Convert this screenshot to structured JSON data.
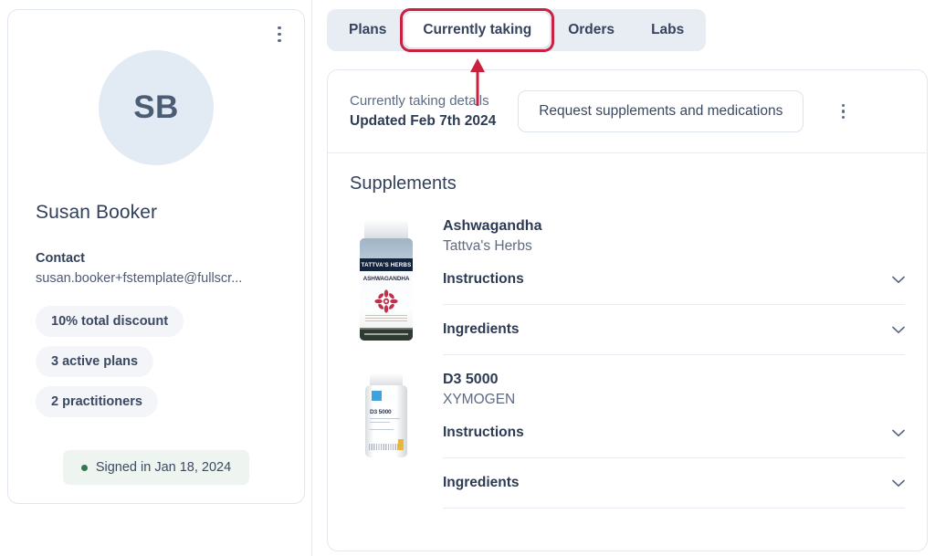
{
  "sidebar": {
    "menu_icon": "kebab-menu-icon",
    "avatar_initials": "SB",
    "name": "Susan Booker",
    "contact_label": "Contact",
    "contact_value": "susan.booker+fstemplate@fullscr...",
    "pills": [
      "10% total discount",
      "3 active plans",
      "2 practitioners"
    ],
    "signed_in": "Signed in Jan 18, 2024",
    "status_dot_color": "#2f7a51"
  },
  "tabs": [
    {
      "label": "Plans",
      "active": false
    },
    {
      "label": "Currently taking",
      "active": true
    },
    {
      "label": "Orders",
      "active": false
    },
    {
      "label": "Labs",
      "active": false
    }
  ],
  "annotation": {
    "color": "#c9213f",
    "target_tab": "Currently taking",
    "shape": "rounded-rect-with-up-arrow"
  },
  "card_header": {
    "subtitle": "Currently taking details",
    "title": "Updated Feb 7th 2024",
    "request_button": "Request supplements and medications",
    "menu_icon": "kebab-menu-icon"
  },
  "main": {
    "section_title": "Supplements",
    "products": [
      {
        "name": "Ashwagandha",
        "brand": "Tattva's Herbs",
        "image_alt": "ashwagandha-bottle",
        "bottle_brand_text": "TATTVA'S HERBS",
        "bottle_product_text": "ASHWAGANDHA",
        "rows": [
          {
            "label": "Instructions",
            "icon": "chevron-down-icon"
          },
          {
            "label": "Ingredients",
            "icon": "chevron-down-icon"
          }
        ]
      },
      {
        "name": "D3 5000",
        "brand": "XYMOGEN",
        "image_alt": "d3-5000-bottle",
        "bottle_product_text": "D3 5000",
        "rows": [
          {
            "label": "Instructions",
            "icon": "chevron-down-icon"
          },
          {
            "label": "Ingredients",
            "icon": "chevron-down-icon"
          }
        ]
      }
    ]
  }
}
